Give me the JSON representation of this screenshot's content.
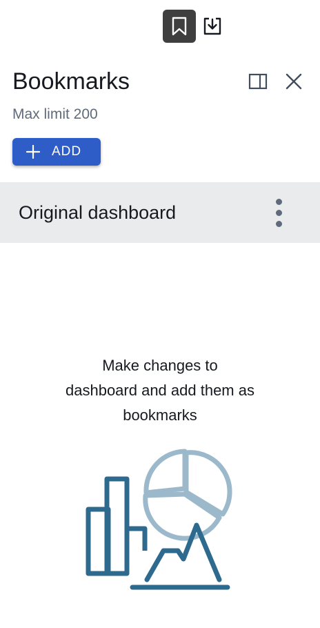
{
  "toolbar": {
    "bookmark_icon": "bookmark-icon",
    "download_icon": "download-icon",
    "active_color": "#3f3f3f"
  },
  "panel": {
    "title": "Bookmarks",
    "subtitle": "Max limit 200",
    "split_icon": "split-view-icon",
    "close_icon": "close-icon"
  },
  "add_button": {
    "label": "ADD",
    "icon": "plus-icon",
    "color": "#2f5dc8"
  },
  "bookmarks": [
    {
      "label": "Original dashboard",
      "menu_icon": "more-vertical-icon"
    }
  ],
  "empty_state": {
    "line1": "Make changes to",
    "line2": "dashboard and add them as",
    "line3": "bookmarks",
    "illustration": "charts-illustration",
    "colors": {
      "dark": "#2e6a8e",
      "light": "#9cb9cc"
    }
  }
}
